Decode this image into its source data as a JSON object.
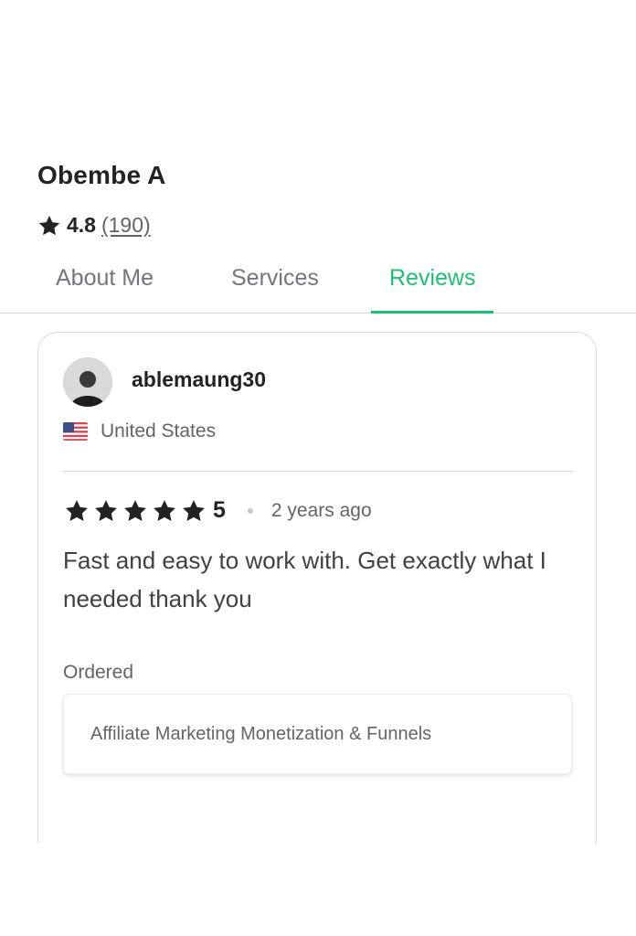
{
  "seller": {
    "name": "Obembe A",
    "rating": "4.8",
    "review_count": "(190)"
  },
  "tabs": [
    {
      "label": "About Me",
      "active": false
    },
    {
      "label": "Services",
      "active": false
    },
    {
      "label": "Reviews",
      "active": true
    }
  ],
  "review": {
    "reviewer": "ablemaung30",
    "country": "United States",
    "country_flag": "us-flag-icon",
    "stars": 5,
    "score": "5",
    "date": "2 years ago",
    "text": "Fast and easy to work with. Get exactly what I needed thank you",
    "ordered_label": "Ordered",
    "ordered_service": "Affiliate Marketing Monetization & Funnels"
  },
  "colors": {
    "accent": "#1dbf73",
    "text_primary": "#222325",
    "text_secondary": "#62646a",
    "border": "#dadbdd"
  }
}
